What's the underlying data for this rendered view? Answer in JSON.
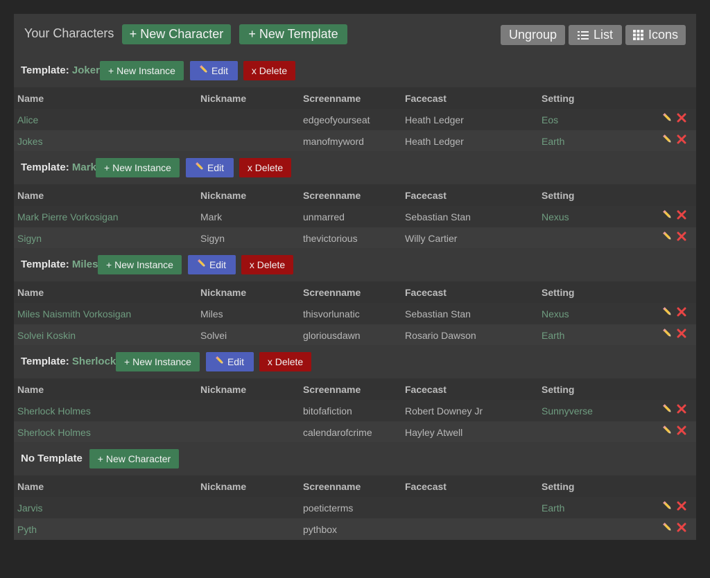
{
  "header": {
    "title": "Your Characters",
    "new_character": "+ New Character",
    "new_template": "+ New Template",
    "ungroup": "Ungroup",
    "list": "List",
    "icons": "Icons"
  },
  "columns": [
    "Name",
    "Nickname",
    "Screenname",
    "Facecast",
    "Setting"
  ],
  "groups": [
    {
      "label": "Template:",
      "name": "Joker",
      "new_instance": "+ New Instance",
      "edit": "Edit",
      "delete": "x Delete",
      "rows": [
        {
          "name": "Alice",
          "nickname": "",
          "screenname": "edgeofyourseat",
          "facecast": "Heath Ledger",
          "setting": "Eos"
        },
        {
          "name": "Jokes",
          "nickname": "",
          "screenname": "manofmyword",
          "facecast": "Heath Ledger",
          "setting": "Earth"
        }
      ]
    },
    {
      "label": "Template:",
      "name": "Mark",
      "new_instance": "+ New Instance",
      "edit": "Edit",
      "delete": "x Delete",
      "rows": [
        {
          "name": "Mark Pierre Vorkosigan",
          "nickname": "Mark",
          "screenname": "unmarred",
          "facecast": "Sebastian Stan",
          "setting": "Nexus"
        },
        {
          "name": "Sigyn",
          "nickname": "Sigyn",
          "screenname": "thevictorious",
          "facecast": "Willy Cartier",
          "setting": ""
        }
      ]
    },
    {
      "label": "Template:",
      "name": "Miles",
      "new_instance": "+ New Instance",
      "edit": "Edit",
      "delete": "x Delete",
      "rows": [
        {
          "name": "Miles Naismith Vorkosigan",
          "nickname": "Miles",
          "screenname": "thisvorlunatic",
          "facecast": "Sebastian Stan",
          "setting": "Nexus"
        },
        {
          "name": "Solvei Koskin",
          "nickname": "Solvei",
          "screenname": "gloriousdawn",
          "facecast": "Rosario Dawson",
          "setting": "Earth"
        }
      ]
    },
    {
      "label": "Template:",
      "name": "Sherlock",
      "new_instance": "+ New Instance",
      "edit": "Edit",
      "delete": "x Delete",
      "rows": [
        {
          "name": "Sherlock Holmes",
          "nickname": "",
          "screenname": "bitofafiction",
          "facecast": "Robert Downey Jr",
          "setting": "Sunnyverse"
        },
        {
          "name": "Sherlock Holmes",
          "nickname": "",
          "screenname": "calendarofcrime",
          "facecast": "Hayley Atwell",
          "setting": ""
        }
      ]
    }
  ],
  "no_template": {
    "label": "No Template",
    "new_character": "+ New Character",
    "rows": [
      {
        "name": "Jarvis",
        "nickname": "",
        "screenname": "poeticterms",
        "facecast": "",
        "setting": "Earth"
      },
      {
        "name": "Pyth",
        "nickname": "",
        "screenname": "pythbox",
        "facecast": "",
        "setting": ""
      }
    ]
  },
  "icons": {
    "list": "list-icon",
    "grid": "grid-icon",
    "edit": "pencil-icon",
    "delete": "red-x-icon"
  },
  "colors": {
    "accent_green": "#3f7d55",
    "edit_blue": "#4e5fbb",
    "delete_red": "#9c0f0f",
    "link_green": "#6f9d80"
  }
}
